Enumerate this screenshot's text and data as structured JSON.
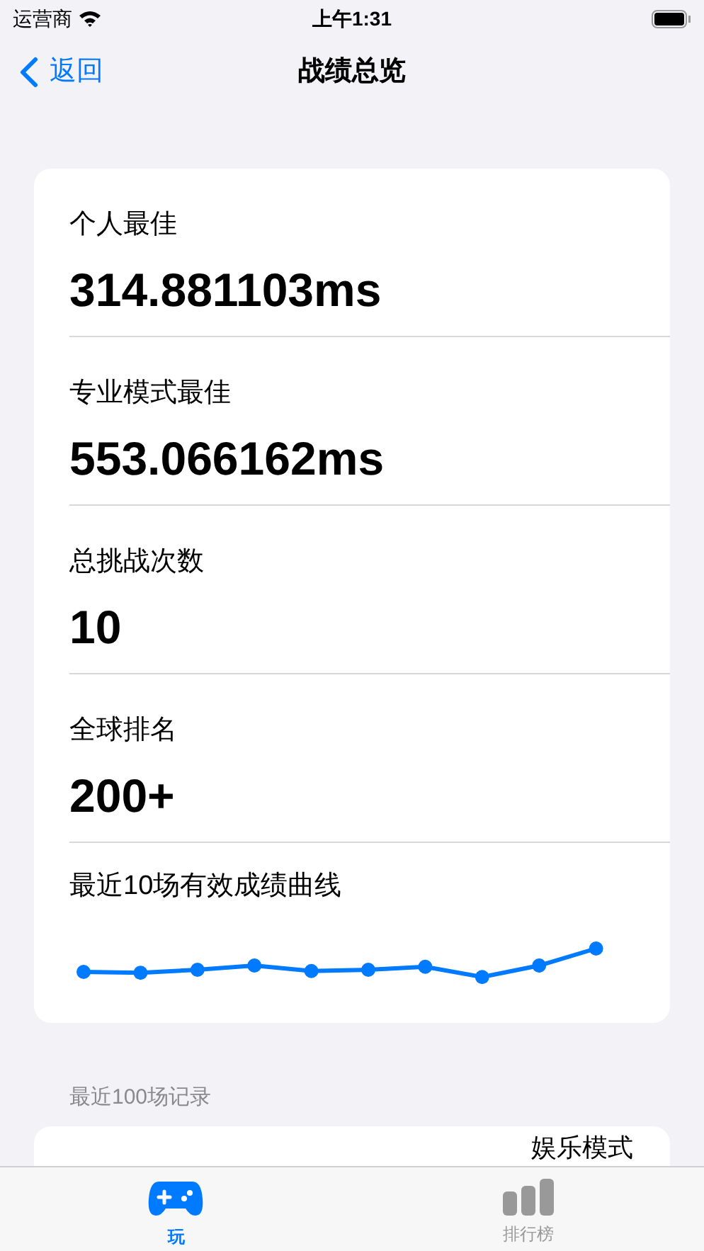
{
  "status_bar": {
    "carrier": "运营商",
    "time": "上午1:31"
  },
  "nav": {
    "back": "返回",
    "title": "战绩总览"
  },
  "stats": [
    {
      "label": "个人最佳",
      "value": "314.881103ms"
    },
    {
      "label": "专业模式最佳",
      "value": "553.066162ms"
    },
    {
      "label": "总挑战次数",
      "value": "10"
    },
    {
      "label": "全球排名",
      "value": "200+"
    }
  ],
  "trend": {
    "title": "最近10场有效成绩曲线"
  },
  "records": {
    "header": "最近100场记录",
    "items": [
      {
        "mode": "娱乐模式"
      }
    ]
  },
  "tab_bar": [
    {
      "label": "玩",
      "kind": "game",
      "selected": true
    },
    {
      "label": "排行榜",
      "kind": "chart",
      "selected": false
    }
  ]
}
